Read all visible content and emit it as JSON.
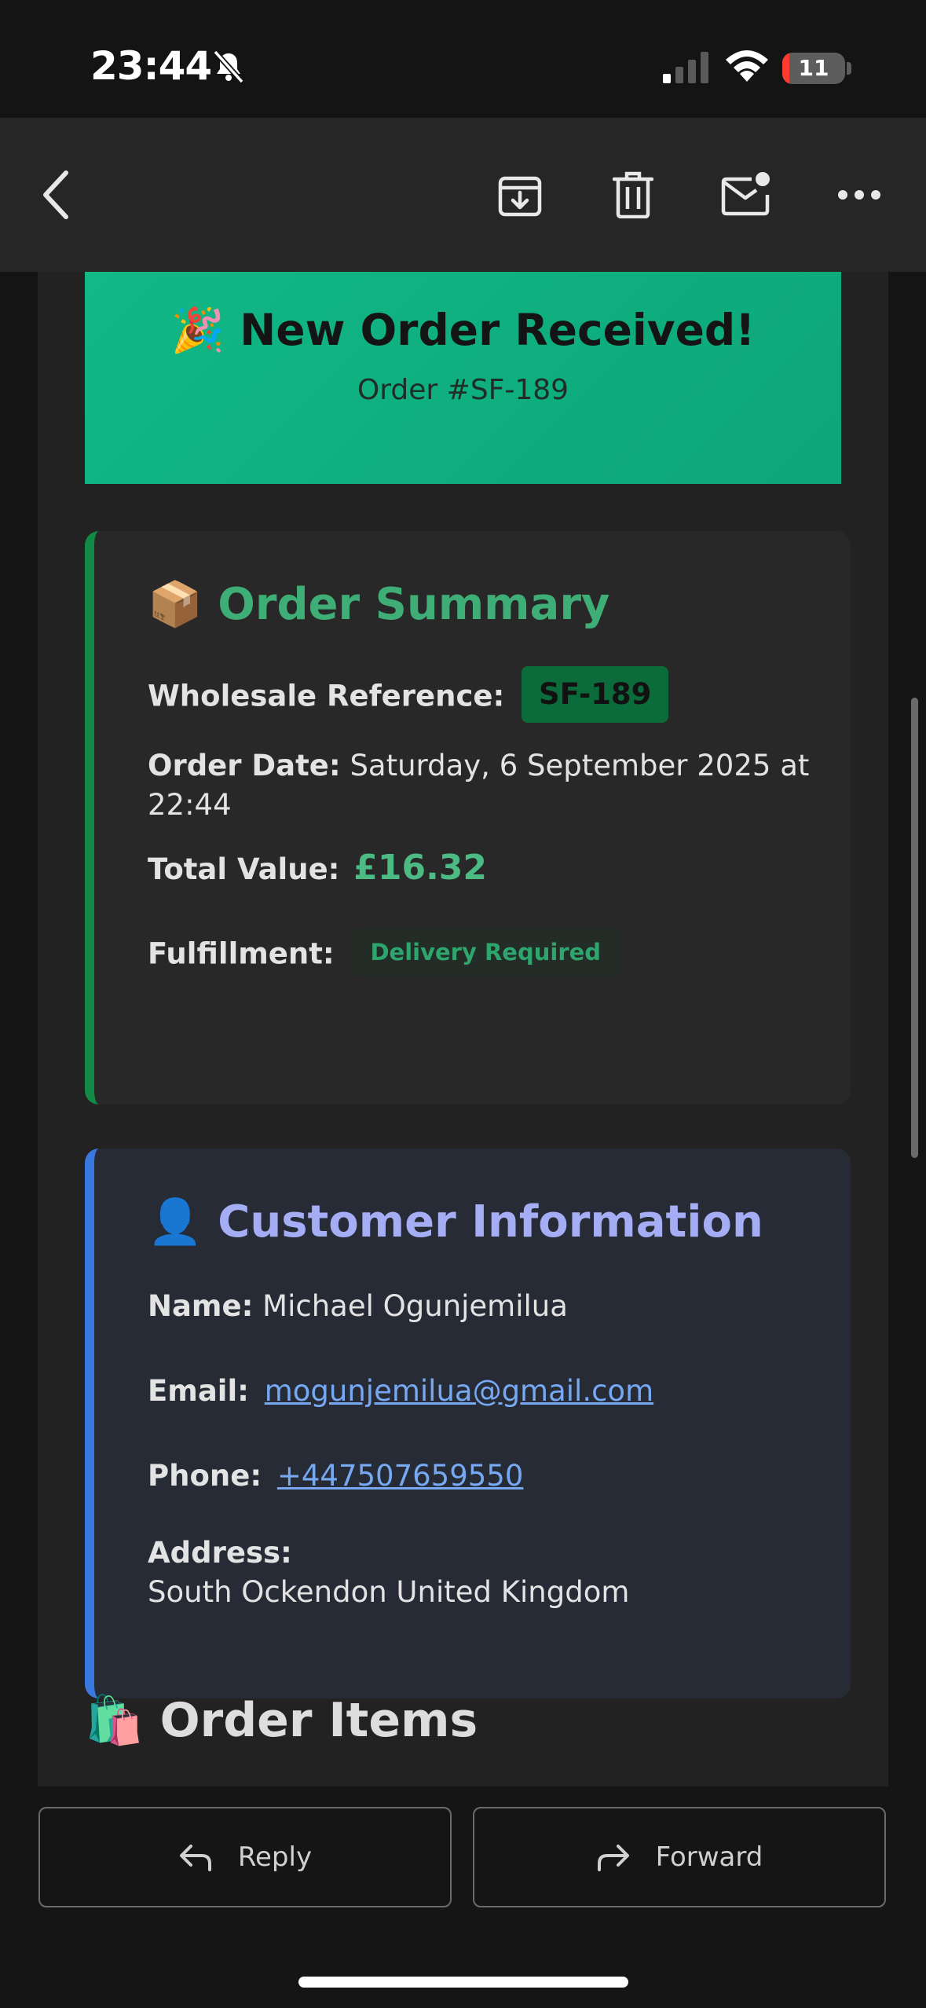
{
  "status_bar": {
    "time": "23:44",
    "battery_level": "11",
    "battery_fraction": 0.11,
    "icons": [
      "bell-slash-icon",
      "cellular-signal-icon",
      "wifi-icon",
      "battery-icon"
    ]
  },
  "toolbar": {
    "icons": [
      "back-chevron-icon",
      "archive-icon",
      "trash-icon",
      "mark-unread-icon",
      "more-icon"
    ]
  },
  "hero": {
    "title": "🎉 New Order Received!",
    "subtitle": "Order #SF-189",
    "accent": "#12b886"
  },
  "order_summary": {
    "title": "📦 Order Summary",
    "wholesale_reference_label": "Wholesale Reference:",
    "wholesale_reference": "SF-189",
    "order_date_label": "Order Date:",
    "order_date": "Saturday, 6 September 2025 at 22:44",
    "total_value_label": "Total Value:",
    "total_value": "£16.32",
    "fulfillment_label": "Fulfillment:",
    "fulfillment": "Delivery Required",
    "accent": "#128a45"
  },
  "customer_info": {
    "title": "👤 Customer Information",
    "name_label": "Name:",
    "name": "Michael Ogunjemilua",
    "email_label": "Email:",
    "email": "mogunjemilua@gmail.com",
    "phone_label": "Phone:",
    "phone": "+447507659550",
    "address_label": "Address:",
    "address": "South Ockendon United Kingdom",
    "accent": "#3a78e0"
  },
  "order_items": {
    "title": "🛍️ Order Items"
  },
  "actions": {
    "reply_label": "Reply",
    "forward_label": "Forward"
  }
}
